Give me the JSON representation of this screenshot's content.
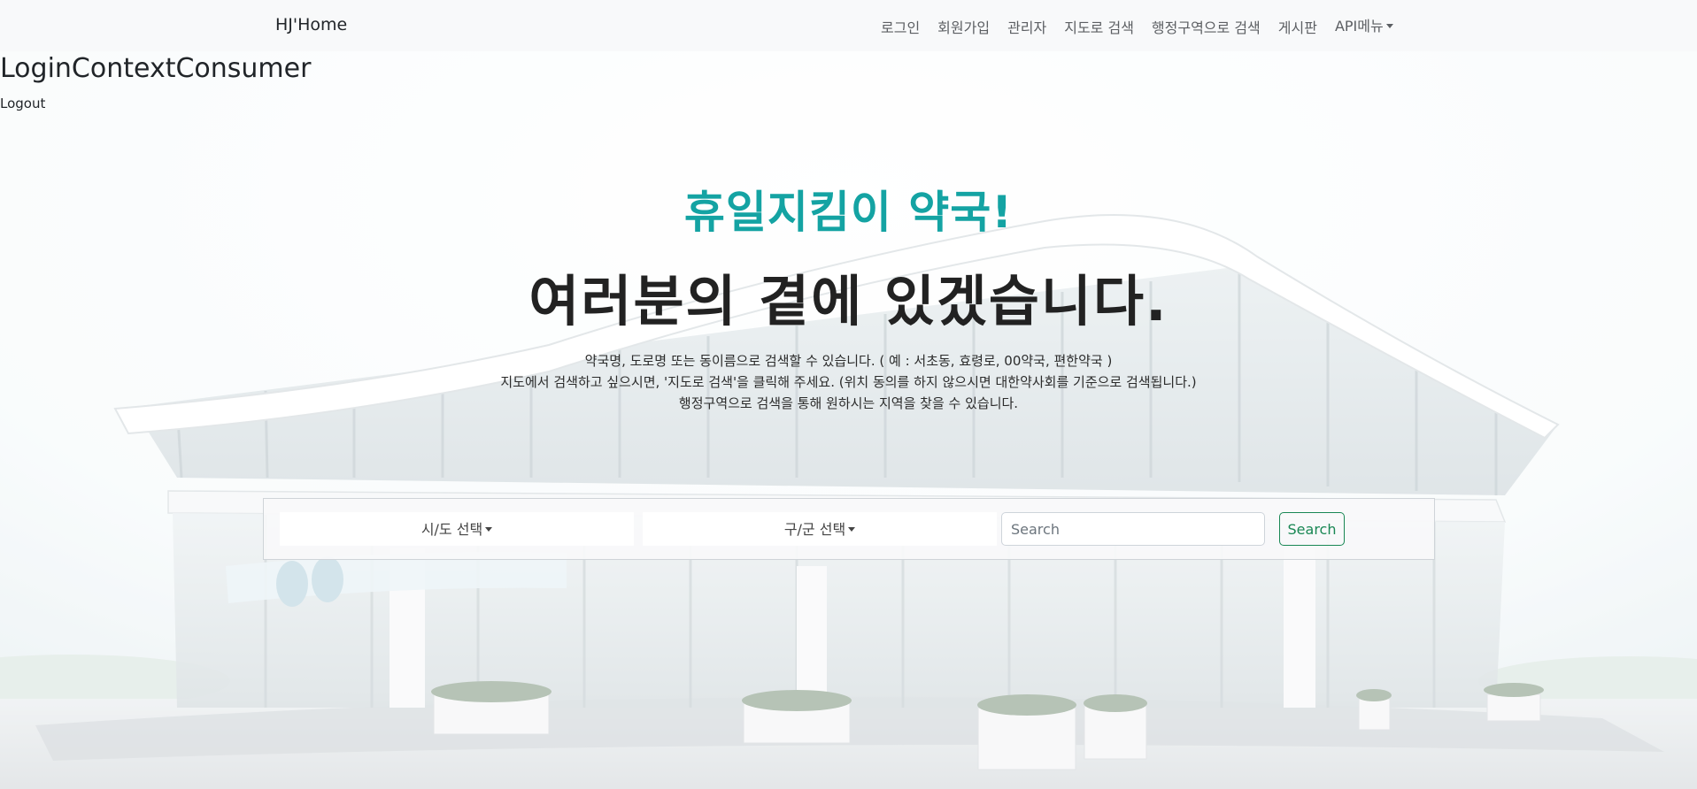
{
  "navbar": {
    "brand": "HJ'Home",
    "links": [
      {
        "label": "로그인"
      },
      {
        "label": "회원가입"
      },
      {
        "label": "관리자"
      },
      {
        "label": "지도로 검색"
      },
      {
        "label": "행정구역으로 검색"
      },
      {
        "label": "게시판"
      }
    ],
    "api_menu_label": "API메뉴"
  },
  "context": {
    "title": "LoginContextConsumer",
    "logout_label": "Logout"
  },
  "hero": {
    "title": "휴일지킴이 약국!",
    "subtitle": "여러분의 곁에 있겠습니다.",
    "description": [
      "약국명, 도로명 또는 동이름으로 검색할 수 있습니다. ( 예 : 서초동, 효령로, 00약국, 편한약국 )",
      "지도에서 검색하고 싶으시면, '지도로 검색'을 클릭해 주세요. (위치 동의를 하지 않으시면 대한약사회를 기준으로 검색됩니다.)",
      "행정구역으로 검색을 통해 원하시는 지역을 찾을 수 있습니다."
    ]
  },
  "search": {
    "sido_label": "시/도 선택",
    "gugun_label": "구/군 선택",
    "placeholder": "Search",
    "value": "",
    "button_label": "Search"
  },
  "colors": {
    "accent_title": "#14a3a3",
    "search_button": "#198754",
    "navbar_bg": "#f8f9fa"
  }
}
